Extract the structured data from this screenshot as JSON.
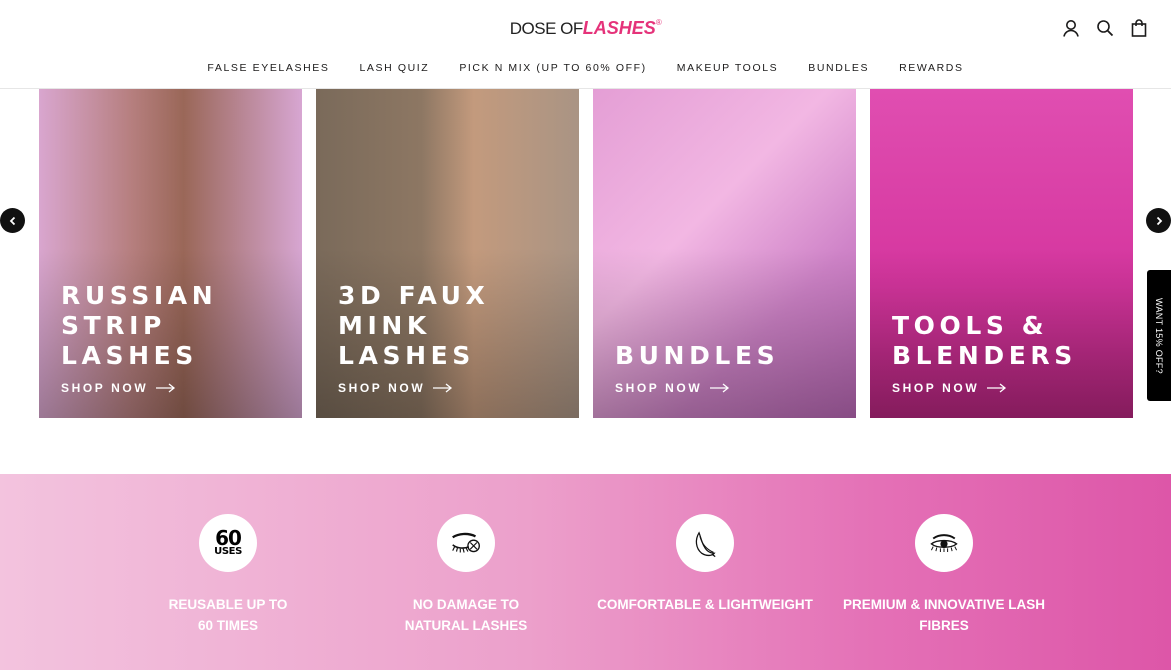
{
  "header": {
    "logo": {
      "part1": "DOSE OF",
      "part2": "LASHES",
      "mark": "®"
    },
    "icons": [
      "account-icon",
      "search-icon",
      "cart-icon"
    ]
  },
  "nav": {
    "items": [
      {
        "label": "FALSE EYELASHES"
      },
      {
        "label": "LASH QUIZ"
      },
      {
        "label": "PICK N MIX (UP TO 60% OFF)"
      },
      {
        "label": "MAKEUP TOOLS"
      },
      {
        "label": "BUNDLES"
      },
      {
        "label": "REWARDS"
      }
    ]
  },
  "cards": [
    {
      "title": "RUSSIAN\nSTRIP LASHES",
      "cta": "SHOP NOW"
    },
    {
      "title": "3D FAUX\nMINK LASHES",
      "cta": "SHOP NOW"
    },
    {
      "title": "BUNDLES",
      "cta": "SHOP NOW"
    },
    {
      "title": "TOOLS &\nBLENDERS",
      "cta": "SHOP NOW"
    }
  ],
  "promo_tab": {
    "label": "WANT 15% OFF?"
  },
  "features": [
    {
      "icon": "60-uses-icon",
      "icon_top": "60",
      "icon_bottom": "USES",
      "label": "REUSABLE UP TO\n60 TIMES"
    },
    {
      "icon": "no-damage-eye-icon",
      "label": "NO DAMAGE TO\nNATURAL LASHES"
    },
    {
      "icon": "feather-icon",
      "label": "COMFORTABLE & LIGHTWEIGHT"
    },
    {
      "icon": "lash-eye-icon",
      "label": "PREMIUM & INNOVATIVE LASH\nFIBRES"
    }
  ],
  "colors": {
    "brand_pink": "#e5337a",
    "band_start": "#f3c3de",
    "band_end": "#dd56a8"
  }
}
